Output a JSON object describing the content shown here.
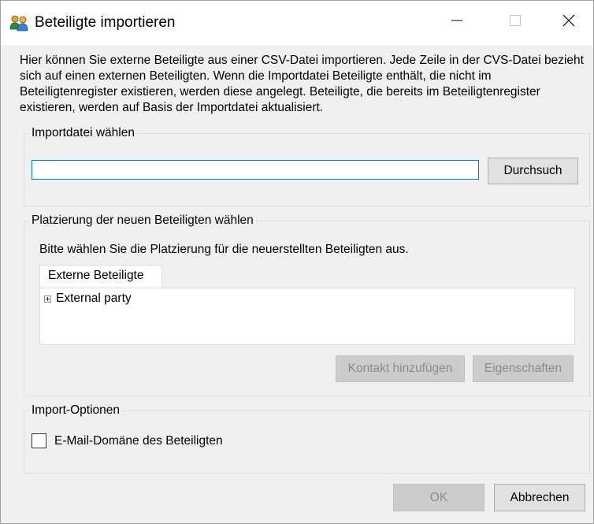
{
  "window": {
    "title": "Beteiligte importieren",
    "icon": "people-icon",
    "controls": [
      "minimize-icon",
      "maximize-icon",
      "close-icon"
    ]
  },
  "intro_text": "Hier können Sie externe Beteiligte aus einer CSV-Datei importieren. Jede Zeile in der CVS-Datei bezieht sich auf einen externen Beteiligten. Wenn die Importdatei Beteiligte enthält, die nicht im Beteiligtenregister existieren, werden diese angelegt. Beteiligte, die bereits im Beteiligtenregister existieren, werden auf Basis der Importdatei aktualisiert.",
  "import_file": {
    "legend": "Importdatei wählen",
    "value": "",
    "browse_label": "Durchsuch"
  },
  "placement": {
    "legend": "Platzierung der neuen Beteiligten wählen",
    "instruction": "Bitte wählen Sie die Platzierung für die neuerstellten Beteiligten aus.",
    "tab_label": "Externe Beteiligte",
    "tree": [
      {
        "label": "External party",
        "expandable": true
      }
    ],
    "add_contact_label": "Kontakt hinzufügen",
    "properties_label": "Eigenschaften"
  },
  "options": {
    "legend": "Import-Optionen",
    "checkbox_label": "E-Mail-Domäne des Beteiligten",
    "checked": false
  },
  "footer": {
    "ok_label": "OK",
    "cancel_label": "Abbrechen"
  },
  "colors": {
    "input_focus_border": "#0078d7",
    "disabled_button_bg": "#cccccc",
    "dialog_bg": "#f0f0f0"
  }
}
